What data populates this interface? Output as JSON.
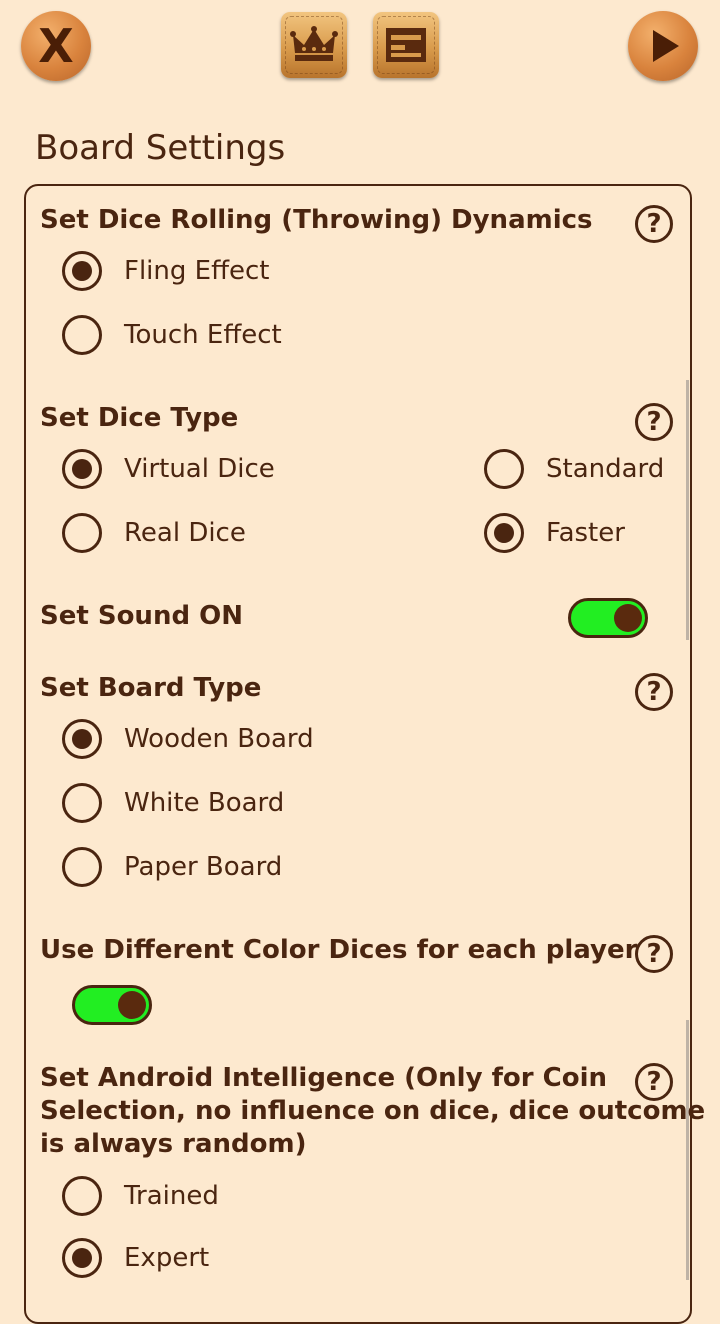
{
  "header": {
    "close_label": "X",
    "crown_icon": "crown-icon",
    "board_icon": "board-icon",
    "play_icon": "play-icon"
  },
  "title": "Board Settings",
  "help_label": "?",
  "sections": {
    "dice_dynamics": {
      "heading": "Set Dice Rolling (Throwing) Dynamics",
      "options": [
        {
          "label": "Fling Effect",
          "selected": true
        },
        {
          "label": "Touch Effect",
          "selected": false
        }
      ]
    },
    "dice_type": {
      "heading": "Set Dice Type",
      "left_options": [
        {
          "label": "Virtual Dice",
          "selected": true
        },
        {
          "label": "Real Dice",
          "selected": false
        }
      ],
      "right_options": [
        {
          "label": "Standard",
          "selected": false
        },
        {
          "label": "Faster",
          "selected": true
        }
      ]
    },
    "sound": {
      "heading": "Set Sound ON",
      "on": true
    },
    "board_type": {
      "heading": "Set Board Type",
      "options": [
        {
          "label": "Wooden Board",
          "selected": true
        },
        {
          "label": "White Board",
          "selected": false
        },
        {
          "label": "Paper Board",
          "selected": false
        }
      ]
    },
    "color_dices": {
      "heading": "Use Different Color Dices for each player",
      "on": true
    },
    "android_intelligence": {
      "heading_line1": "Set Android Intelligence (Only for Coin",
      "heading_line2": "Selection, no influence on dice, dice outcome",
      "heading_line3": "is always random)",
      "options": [
        {
          "label": "Trained",
          "selected": false
        },
        {
          "label": "Expert",
          "selected": true
        }
      ]
    }
  },
  "colors": {
    "background": "#fde9cf",
    "text": "#4a2510",
    "toggle_on": "#22ee22"
  }
}
